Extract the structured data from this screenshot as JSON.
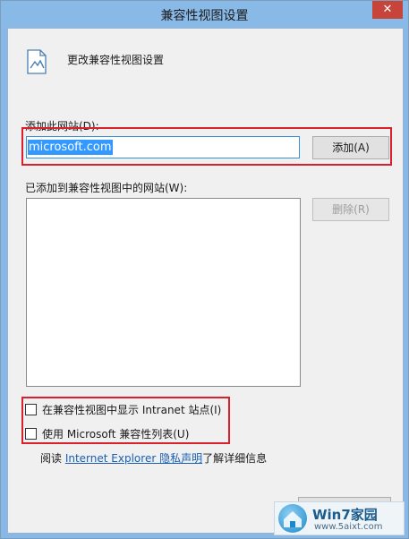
{
  "window": {
    "title": "兼容性视图设置",
    "close_glyph": "✕"
  },
  "header": {
    "text": "更改兼容性视图设置",
    "icon": "compat-view-settings-icon"
  },
  "add_site": {
    "label": "添加此网站(D):",
    "value": "microsoft.com",
    "button": "添加(A)"
  },
  "sites_list": {
    "label": "已添加到兼容性视图中的网站(W):",
    "items": [],
    "remove_button": "删除(R)"
  },
  "options": [
    {
      "label": "在兼容性视图中显示 Intranet 站点(I)",
      "checked": false
    },
    {
      "label": "使用 Microsoft 兼容性列表(U)",
      "checked": false
    }
  ],
  "privacy": {
    "prefix": "阅读 ",
    "link": "Internet Explorer 隐私声明",
    "suffix": "了解详细信息"
  },
  "watermark": {
    "main": "Win7家园",
    "sub": "www.5aixt.com"
  },
  "colors": {
    "highlight": "#d9202c",
    "titlebar": "#89b9e7",
    "selection": "#3399ff",
    "link": "#1a5fb4"
  }
}
